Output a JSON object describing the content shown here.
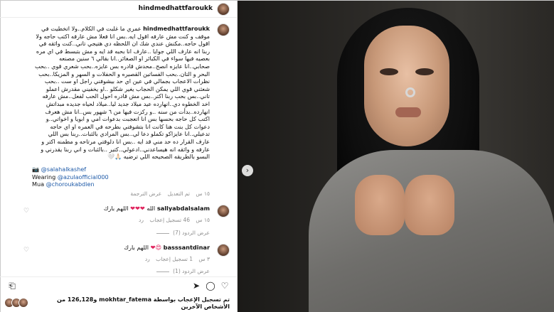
{
  "post": {
    "username": "hindmedhattfaroukk",
    "caption_username": "hindmedhattfaroukk",
    "caption_lines": [
      "عمري ما غلبت في الكلام..ولا اتخطيت في",
      "موقف و كنت مش عارفه اقول ايه..بس انا فعلا مش عارفه اكتب حاجه ولا",
      "اقول حاجه..مكنش عندي شك ان اللحظه دي هتيجي تاني..كنت واثقه في",
      "ربنا انه عارف اللي جوايا ..عارف انا بحبه قد ايه و مش بتبسط في اي مره",
      "بعصيه فيها سواء في الكبائر او الصغائر..انا بقالي ٦ سنين مصنعه",
      "صحابي..انا عايزه انصح..محدش قادره بس عايزه..بحب شعري قوي ..بحب",
      "البحر و التان..بحب الفساتين القصيره و الحفلات و السهر و المزيكا..بحب",
      "نظرات الاعجاب بجمالي في عين اي حد بيشوفني راجل او ست ..بحب",
      "شعثني قوي اللي يمكن الحجاب يغير شكلو ..او يخفيني مقدرش اعملو",
      "تاني..بس بحب ربنا اكتر..بس مش قادره احول الحب لفعل..مش عارفه",
      "اخد الخطوه دي..انهارده عيد ميلاد جديد ليا..ميلاد لحياه جديده مبداتش",
      "انهارده..بدأت من سنه ..و ركزت فيها من ٦ شهور بس..انا مش هعرف",
      "اكتب كل حاجه بحسها بس انا اتعجبت بدعوات امي و ابويا و اخواتي..و",
      "دعوات كل بنت هنا كانت انا بتشوفني بطرحه في العمره او اي حاجه",
      "تدعيلي..انا عايزاكو تكملو دعا لي..بس المرادي بالثبات..ربنا بس اللي",
      "عارف القرار ده حد مني قد ايه ..بس انا دلوقتي مرتاحه و مطمنه اكتر و",
      "عارفه و واثقه انه هيساعدني..ادعولي..كتير ..بالثبات و اني ربنا يقدرني و",
      "البسو بالطريقه الصحيحه اللي ترضيه 🙏🏻🤍"
    ],
    "credits": [
      {
        "prefix": "📷",
        "tag": "@salahalkashef"
      },
      {
        "prefix": "Wearing",
        "tag": "@azulaofficial000"
      },
      {
        "prefix": "Mua",
        "tag": "@choroukabdien"
      }
    ],
    "meta": {
      "time": "١٥ س",
      "edited": "تم التعديل",
      "translate": "عرض الترجمة"
    }
  },
  "comments": [
    {
      "username": "sallyabdalsalam",
      "text": "اللهم بارك",
      "hearts": "❤❤❤",
      "extra": "الله",
      "time": "١٥ س",
      "likes": "46 تسجيل إعجاب",
      "reply": "رد",
      "view_replies": "عرض الردود (7)"
    },
    {
      "username": "basssantdinar",
      "text": "اللهم بارك",
      "hearts": "😍❤",
      "time": "٣ س",
      "likes": "1 تسجيل إعجاب",
      "reply": "رد",
      "view_replies": "عرض الردود (1)"
    }
  ],
  "likes_bar": {
    "text_prefix": "تم تسجيل الإعجاب بواسطة",
    "user": "mokhtar_fatema",
    "text_suffix": "و126,128 من الأشخاص الآخرين"
  },
  "icons": {
    "like": "heart-icon",
    "comment": "comment-icon",
    "share": "share-icon",
    "save": "bookmark-icon",
    "next": "chevron-right-icon"
  }
}
